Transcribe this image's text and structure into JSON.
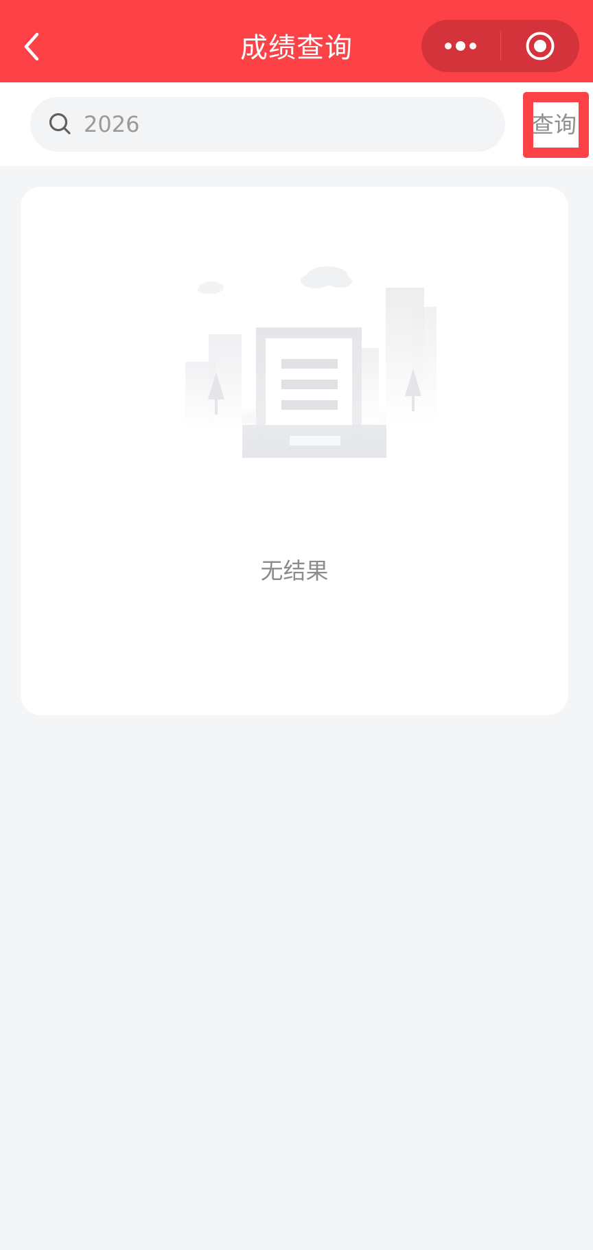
{
  "header": {
    "title": "成绩查询",
    "back_icon": "chevron-left-icon",
    "menu_icon": "more-dots-icon",
    "close_icon": "target-circle-icon",
    "background_color": "#fc4147",
    "capsule_color": "#d4333b"
  },
  "search": {
    "value": "2026",
    "placeholder": "",
    "icon": "search-icon",
    "button_label": "查询",
    "highlight_color": "#fc4147"
  },
  "results": {
    "empty_text": "无结果",
    "illustration": "empty-document-illustration"
  }
}
